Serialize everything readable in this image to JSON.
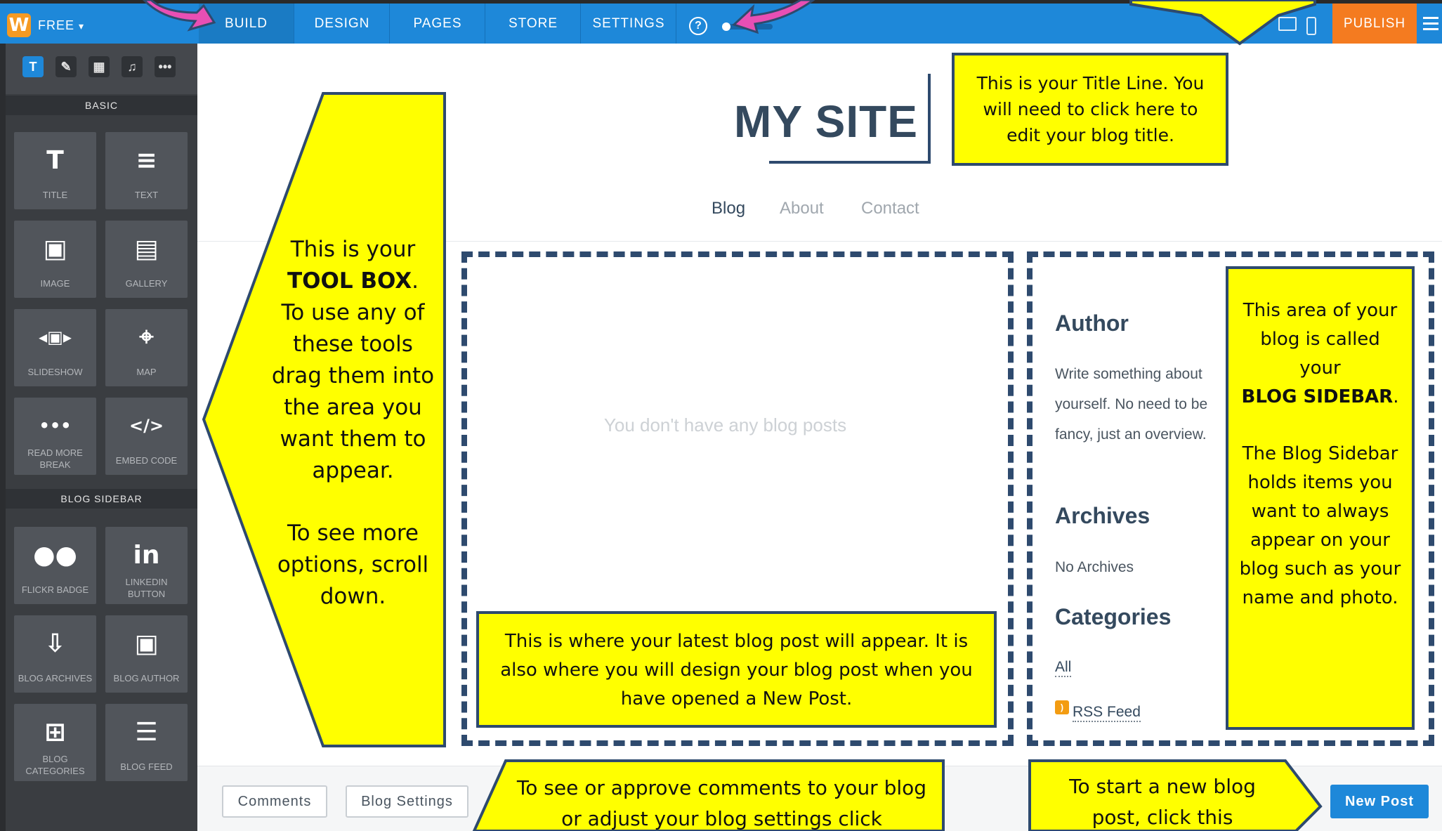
{
  "topbar": {
    "plan": "FREE",
    "tabs": [
      "BUILD",
      "DESIGN",
      "PAGES",
      "STORE",
      "SETTINGS"
    ],
    "help": "?",
    "publish": "PUBLISH"
  },
  "sidebar": {
    "basic_heading": "BASIC",
    "blog_sidebar_heading": "BLOG SIDEBAR",
    "basic_tiles": [
      "TITLE",
      "TEXT",
      "IMAGE",
      "GALLERY",
      "SLIDESHOW",
      "MAP",
      "READ MORE BREAK",
      "EMBED CODE"
    ],
    "blog_tiles": [
      "FLICKR BADGE",
      "LINKEDIN BUTTON",
      "BLOG ARCHIVES",
      "BLOG AUTHOR",
      "BLOG CATEGORIES",
      "BLOG FEED"
    ]
  },
  "page": {
    "site_title": "MY SITE",
    "nav": [
      "Blog",
      "About",
      "Contact"
    ],
    "no_posts": "You don't have any blog posts"
  },
  "blog_sidebar": {
    "author_heading": "Author",
    "author_text": "Write something about yourself. No need to be fancy, just an overview.",
    "archives_heading": "Archives",
    "archives_text": "No Archives",
    "categories_heading": "Categories",
    "categories_all": "All",
    "rss": "RSS Feed"
  },
  "bottom": {
    "comments": "Comments",
    "blog_settings": "Blog Settings",
    "new_post": "New Post"
  },
  "annotations": {
    "toolbox_1": "This is your",
    "toolbox_bold": "TOOL BOX",
    "toolbox_2": "To use any of these tools drag them into the area you want them to appear.",
    "toolbox_3": "To see more options, scroll down.",
    "title_line": "This is your Title Line. You will need to click here to edit your blog title.",
    "latest_post": "This is where your latest blog post will appear. It is also where you will design your blog post when you have opened a New Post.",
    "sidebar_1": "This area of your blog is called your",
    "sidebar_bold": "BLOG SIDEBAR",
    "sidebar_2": "The Blog Sidebar holds items you want to always appear on your blog such as your name and photo.",
    "comments_tip": "To see or approve comments to your blog or adjust your blog settings click",
    "new_post_tip": "To start a new blog post, click this"
  },
  "colors": {
    "topbar": "#1e88d9",
    "publish": "#f47b20",
    "sidebar": "#3a3d41",
    "callout_fill": "#ffff00",
    "callout_border": "#2e4a6e",
    "arrow_pink": "#e84fb4"
  }
}
